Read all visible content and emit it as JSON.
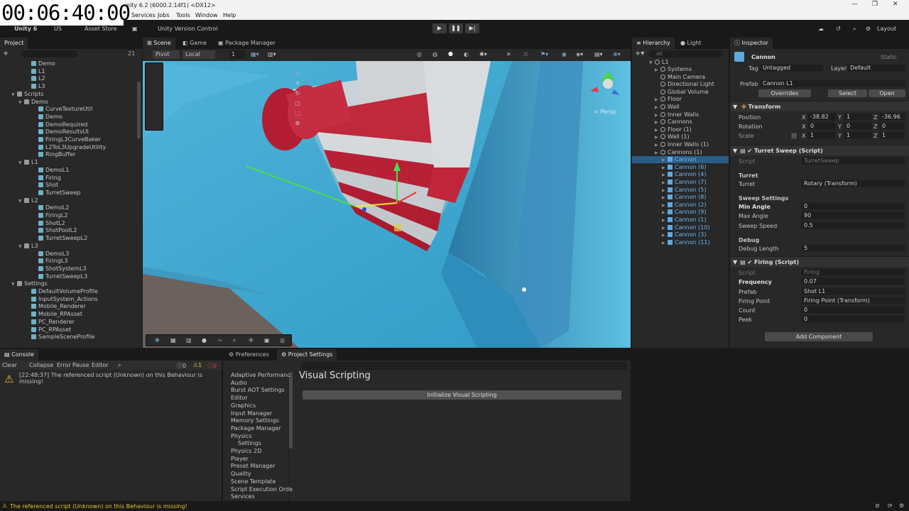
{
  "timer": "00:06:40:00",
  "window": {
    "title": "nity 6.2 (6000.2.14f1) <DX12>"
  },
  "menu": {
    "services": "Services",
    "jobs": "Jobs",
    "tools": "Tools",
    "window": "Window",
    "help": "Help"
  },
  "toolbar": {
    "account": "Unity 6",
    "os": "US",
    "asset_store": "Asset Store",
    "version_control": "Unity Version Control",
    "layout": "Layout"
  },
  "project": {
    "tab": "Project",
    "items": [
      {
        "label": "Demo",
        "indent": 3,
        "icon": "script"
      },
      {
        "label": "L1",
        "indent": 3,
        "icon": "script"
      },
      {
        "label": "L2",
        "indent": 3,
        "icon": "script"
      },
      {
        "label": "L3",
        "indent": 3,
        "icon": "script"
      },
      {
        "label": "Scripts",
        "indent": 1,
        "icon": "folder",
        "arrow": true
      },
      {
        "label": "Demo",
        "indent": 2,
        "icon": "folder",
        "arrow": true
      },
      {
        "label": "CurveTextureUtil",
        "indent": 4,
        "icon": "script"
      },
      {
        "label": "Demo",
        "indent": 4,
        "icon": "script"
      },
      {
        "label": "DemoRequired",
        "indent": 4,
        "icon": "script"
      },
      {
        "label": "DemoResultsUI",
        "indent": 4,
        "icon": "script"
      },
      {
        "label": "FiringL3CurveBaker",
        "indent": 4,
        "icon": "script"
      },
      {
        "label": "L2ToL3UpgradeUtility",
        "indent": 4,
        "icon": "script"
      },
      {
        "label": "RingBuffer",
        "indent": 4,
        "icon": "script"
      },
      {
        "label": "L1",
        "indent": 2,
        "icon": "folder",
        "arrow": true
      },
      {
        "label": "DemoL1",
        "indent": 4,
        "icon": "script"
      },
      {
        "label": "Firing",
        "indent": 4,
        "icon": "script"
      },
      {
        "label": "Shot",
        "indent": 4,
        "icon": "script"
      },
      {
        "label": "TurretSweep",
        "indent": 4,
        "icon": "script"
      },
      {
        "label": "L2",
        "indent": 2,
        "icon": "folder",
        "arrow": true
      },
      {
        "label": "DemoL2",
        "indent": 4,
        "icon": "script"
      },
      {
        "label": "FiringL2",
        "indent": 4,
        "icon": "script"
      },
      {
        "label": "ShotL2",
        "indent": 4,
        "icon": "script"
      },
      {
        "label": "ShotPoolL2",
        "indent": 4,
        "icon": "script"
      },
      {
        "label": "TurretSweepL2",
        "indent": 4,
        "icon": "script"
      },
      {
        "label": "L3",
        "indent": 2,
        "icon": "folder",
        "arrow": true
      },
      {
        "label": "DemoL3",
        "indent": 4,
        "icon": "script"
      },
      {
        "label": "FiringL3",
        "indent": 4,
        "icon": "script"
      },
      {
        "label": "ShotSystemL3",
        "indent": 4,
        "icon": "script"
      },
      {
        "label": "TurretSweepL3",
        "indent": 4,
        "icon": "script"
      },
      {
        "label": "Settings",
        "indent": 1,
        "icon": "folder",
        "arrow": true
      },
      {
        "label": "DefaultVolumeProfile",
        "indent": 3,
        "icon": "script"
      },
      {
        "label": "InputSystem_Actions",
        "indent": 3,
        "icon": "script"
      },
      {
        "label": "Mobile_Renderer",
        "indent": 3,
        "icon": "script"
      },
      {
        "label": "Mobile_RPAsset",
        "indent": 3,
        "icon": "script"
      },
      {
        "label": "PC_Renderer",
        "indent": 3,
        "icon": "script"
      },
      {
        "label": "PC_RPAsset",
        "indent": 3,
        "icon": "script"
      },
      {
        "label": "SampleSceneProfile",
        "indent": 3,
        "icon": "script"
      }
    ],
    "count": "21"
  },
  "scene": {
    "tabs": [
      "Scene",
      "Game",
      "Package Manager"
    ],
    "pivot": "Pivot",
    "local": "Local",
    "grid_value": "1",
    "persp": "< Persp"
  },
  "hierarchy": {
    "tabs": [
      "Hierarchy",
      "Light"
    ],
    "search": "All",
    "root": "L1",
    "items": [
      {
        "label": "Systems",
        "indent": 1,
        "prefab": false,
        "arrow": true
      },
      {
        "label": "Main Camera",
        "indent": 1,
        "prefab": false
      },
      {
        "label": "Directional Light",
        "indent": 1,
        "prefab": false
      },
      {
        "label": "Global Volume",
        "indent": 1,
        "prefab": false
      },
      {
        "label": "Floor",
        "indent": 1,
        "prefab": false,
        "arrow": true
      },
      {
        "label": "Wall",
        "indent": 1,
        "prefab": false,
        "arrow": true
      },
      {
        "label": "Inner Walls",
        "indent": 1,
        "prefab": false,
        "arrow": true
      },
      {
        "label": "Cannons",
        "indent": 1,
        "prefab": false,
        "arrow": true
      },
      {
        "label": "Floor (1)",
        "indent": 1,
        "prefab": false,
        "arrow": true
      },
      {
        "label": "Wall (1)",
        "indent": 1,
        "prefab": false,
        "arrow": true
      },
      {
        "label": "Inner Walls (1)",
        "indent": 1,
        "prefab": false,
        "arrow": true
      },
      {
        "label": "Cannons (1)",
        "indent": 1,
        "prefab": false,
        "arrow": true
      },
      {
        "label": "Cannon",
        "indent": 2,
        "prefab": true,
        "arrow": true,
        "selected": true
      },
      {
        "label": "Cannon (6)",
        "indent": 2,
        "prefab": true,
        "arrow": true
      },
      {
        "label": "Cannon (4)",
        "indent": 2,
        "prefab": true,
        "arrow": true
      },
      {
        "label": "Cannon (7)",
        "indent": 2,
        "prefab": true,
        "arrow": true
      },
      {
        "label": "Cannon (5)",
        "indent": 2,
        "prefab": true,
        "arrow": true
      },
      {
        "label": "Cannon (8)",
        "indent": 2,
        "prefab": true,
        "arrow": true
      },
      {
        "label": "Cannon (2)",
        "indent": 2,
        "prefab": true,
        "arrow": true
      },
      {
        "label": "Cannon (9)",
        "indent": 2,
        "prefab": true,
        "arrow": true
      },
      {
        "label": "Cannon (1)",
        "indent": 2,
        "prefab": true,
        "arrow": true
      },
      {
        "label": "Cannon (10)",
        "indent": 2,
        "prefab": true,
        "arrow": true
      },
      {
        "label": "Cannon (3)",
        "indent": 2,
        "prefab": true,
        "arrow": true
      },
      {
        "label": "Cannon (11)",
        "indent": 2,
        "prefab": true,
        "arrow": true
      }
    ]
  },
  "inspector": {
    "tab": "Inspector",
    "name": "Cannon",
    "static": "Static",
    "tag_label": "Tag",
    "tag": "Untagged",
    "layer_label": "Layer",
    "layer": "Default",
    "prefab_label": "Prefab",
    "prefab": "Cannon L1",
    "overrides": "Overrides",
    "select": "Select",
    "open": "Open",
    "transform": {
      "header": "Transform",
      "position_label": "Position",
      "pos_x": "-38.82",
      "pos_y": "1",
      "pos_z": "-36.96",
      "rotation_label": "Rotation",
      "rot_x": "0",
      "rot_y": "0",
      "rot_z": "0",
      "scale_label": "Scale",
      "scl_x": "1",
      "scl_y": "1",
      "scl_z": "1"
    },
    "turret_sweep": {
      "header": "Turret Sweep (Script)",
      "script_label": "Script",
      "script": "TurretSweep",
      "section_turret": "Turret",
      "turret_label": "Turret",
      "turret": "Rotary (Transform)",
      "section_sweep": "Sweep Settings",
      "min_angle_label": "Min Angle",
      "min_angle": "0",
      "max_angle_label": "Max Angle",
      "max_angle": "90",
      "sweep_speed_label": "Sweep Speed",
      "sweep_speed": "0.5",
      "section_debug": "Debug",
      "debug_length_label": "Debug Length",
      "debug_length": "5"
    },
    "firing": {
      "header": "Firing (Script)",
      "script_label": "Script",
      "script": "Firing",
      "frequency_label": "Frequency",
      "frequency": "0.07",
      "prefab_label": "Prefab",
      "prefab": "Shot L1",
      "firing_point_label": "Firing Point",
      "firing_point": "Firing Point (Transform)",
      "count_label": "Count",
      "count": "0",
      "peek_label": "Peek",
      "peek": "0"
    },
    "add_component": "Add Component"
  },
  "console": {
    "tab": "Console",
    "clear": "Clear",
    "collapse": "Collapse",
    "error_pause": "Error Pause",
    "editor": "Editor",
    "msg_count": "0",
    "warn_count": "1",
    "err_count": "0",
    "message": "[22:48:37] The referenced script (Unknown) on this Behaviour is missing!"
  },
  "settings": {
    "tabs": [
      "Preferences",
      "Project Settings"
    ],
    "items": [
      "Adaptive Performanc",
      "Audio",
      "Burst AOT Settings",
      "Editor",
      "Graphics",
      "Input Manager",
      "Memory Settings",
      "Package Manager",
      "Physics",
      "Settings",
      "Physics 2D",
      "Player",
      "Preset Manager",
      "Quality",
      "Scene Template",
      "Script Execution Orde",
      "Services"
    ],
    "title": "Visual Scripting",
    "init_button": "Initialize Visual Scripting"
  },
  "status": {
    "message": "The referenced script (Unknown) on this Behaviour is missing!"
  }
}
